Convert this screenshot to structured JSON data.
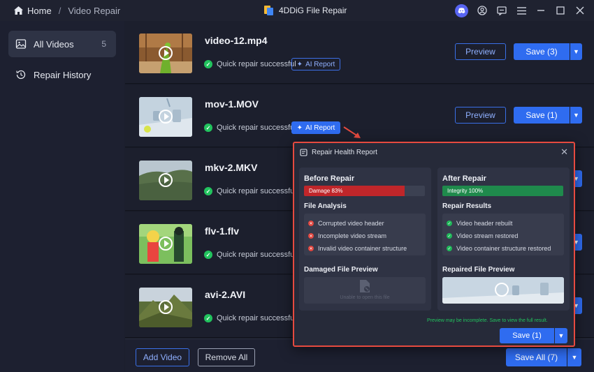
{
  "titlebar": {
    "home": "Home",
    "separator": "/",
    "section": "Video Repair",
    "app_title": "4DDiG File Repair"
  },
  "sidebar": {
    "items": [
      {
        "label": "All Videos",
        "count": "5",
        "icon": "image-icon"
      },
      {
        "label": "Repair History",
        "icon": "history-icon"
      }
    ]
  },
  "videos": [
    {
      "name": "video-12.mp4",
      "status": "Quick repair successful",
      "ai": "AI Report",
      "preview": "Preview",
      "save": "Save (3)"
    },
    {
      "name": "mov-1.MOV",
      "status": "Quick repair successful",
      "ai": "AI Report",
      "preview": "Preview",
      "save": "Save (1)"
    },
    {
      "name": "mkv-2.MKV",
      "status": "Quick repair successful"
    },
    {
      "name": "flv-1.flv",
      "status": "Quick repair successful"
    },
    {
      "name": "avi-2.AVI",
      "status": "Quick repair successful"
    }
  ],
  "bottom": {
    "add_video": "Add Video",
    "remove_all": "Remove All",
    "save_all": "Save All (7)"
  },
  "report": {
    "title": "Repair Health Report",
    "before": {
      "title": "Before Repair",
      "bar_label": "Damage 83%",
      "bar_value": 83,
      "bar_color": "#c0262a",
      "section": "File Analysis",
      "items": [
        "Corrupted video header",
        "Incomplete video stream",
        "Invalid video container structure"
      ],
      "preview_title": "Damaged File Preview",
      "preview_text": "Unable to open this file"
    },
    "after": {
      "title": "After Repair",
      "bar_label": "Integrity 100%",
      "bar_value": 100,
      "bar_color": "#1f8a4c",
      "section": "Repair Results",
      "items": [
        "Video header rebuilt",
        "Video stream restored",
        "Video container structure restored"
      ],
      "preview_title": "Repaired File Preview"
    },
    "note": "Preview may be incomplete. Save to view the full result.",
    "save": "Save (1)"
  }
}
